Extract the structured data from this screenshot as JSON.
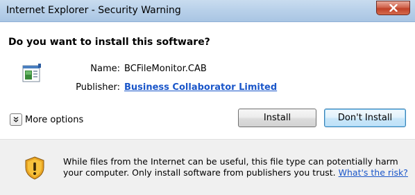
{
  "window": {
    "title": "Internet Explorer - Security Warning",
    "close_icon": "close-icon"
  },
  "dialog": {
    "heading": "Do you want to install this software?",
    "file_icon": "file-icon",
    "name_label": "Name:",
    "name_value": "BCFileMonitor.CAB",
    "publisher_label": "Publisher:",
    "publisher_value": "Business Collaborator Limited",
    "more_options_icon": "chevron-down-icon",
    "more_options_label": "More options",
    "install_label": "Install",
    "dont_install_label": "Don't Install"
  },
  "footer": {
    "shield_icon": "shield-warning-icon",
    "warning_line1": "While files from the Internet can be useful, this file type can potentially harm",
    "warning_line2": "your computer. Only install software from publishers you trust.",
    "risk_link": "What's the risk?"
  },
  "colors": {
    "link": "#1a56c9",
    "titlebar": "#b9d1ea",
    "close_button": "#c04128",
    "footer_bg": "#f0f0f0",
    "default_button_border": "#3c7fb1"
  }
}
